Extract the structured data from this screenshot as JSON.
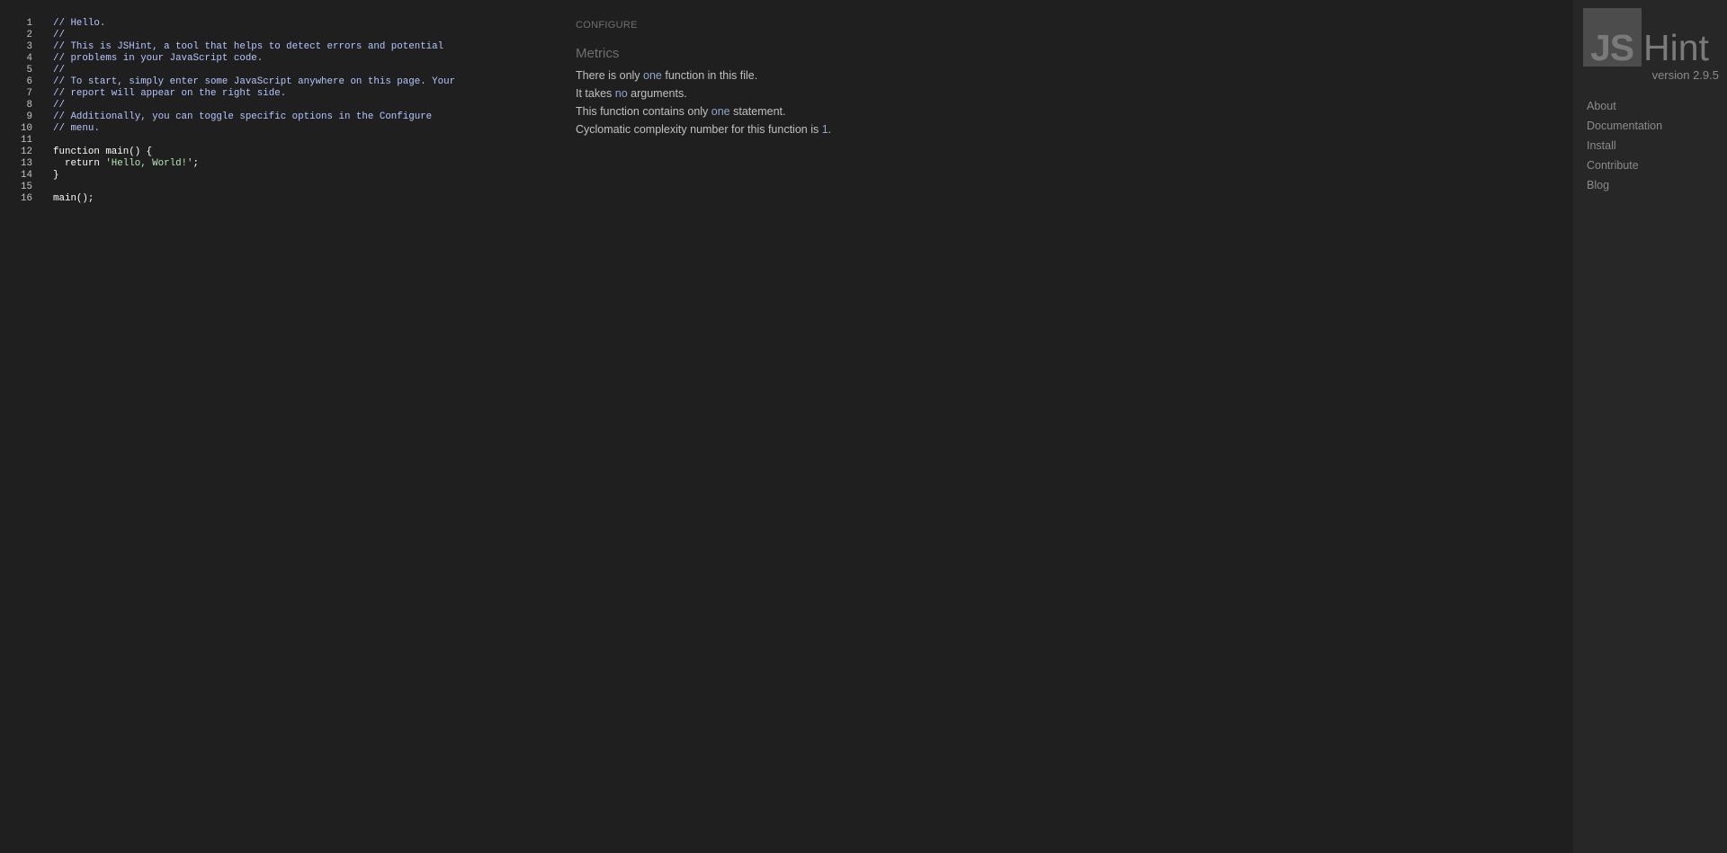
{
  "editor": {
    "lines": [
      {
        "num": "1",
        "code": "// Hello.",
        "type": "comment"
      },
      {
        "num": "2",
        "code": "//",
        "type": "comment"
      },
      {
        "num": "3",
        "code": "// This is JSHint, a tool that helps to detect errors and potential",
        "type": "comment"
      },
      {
        "num": "4",
        "code": "// problems in your JavaScript code.",
        "type": "comment"
      },
      {
        "num": "5",
        "code": "//",
        "type": "comment"
      },
      {
        "num": "6",
        "code": "// To start, simply enter some JavaScript anywhere on this page. Your",
        "type": "comment"
      },
      {
        "num": "7",
        "code": "// report will appear on the right side.",
        "type": "comment"
      },
      {
        "num": "8",
        "code": "//",
        "type": "comment"
      },
      {
        "num": "9",
        "code": "// Additionally, you can toggle specific options in the Configure",
        "type": "comment"
      },
      {
        "num": "10",
        "code": "// menu.",
        "type": "comment"
      },
      {
        "num": "11",
        "code": "",
        "type": "default"
      },
      {
        "num": "12",
        "code": "function main() {",
        "type": "default"
      },
      {
        "num": "13",
        "code": "  return 'Hello, World!';",
        "type": "default"
      },
      {
        "num": "14",
        "code": "}",
        "type": "default"
      },
      {
        "num": "15",
        "code": "",
        "type": "default"
      },
      {
        "num": "16",
        "code": "main();",
        "type": "default"
      }
    ]
  },
  "report": {
    "configure_label": "CONFIGURE",
    "metrics_heading": "Metrics",
    "metrics": [
      {
        "pre": "There is only ",
        "val": "one",
        "post": " function in this file."
      },
      {
        "pre": "It takes ",
        "val": "no",
        "post": " arguments."
      },
      {
        "pre": "This function contains only ",
        "val": "one",
        "post": " statement."
      },
      {
        "pre": "Cyclomatic complexity number for this function is ",
        "val": "1",
        "post": "."
      }
    ]
  },
  "sidebar": {
    "logo_js": "JS",
    "logo_hint": "Hint",
    "version": "version 2.9.5",
    "nav": [
      "About",
      "Documentation",
      "Install",
      "Contribute",
      "Blog"
    ]
  },
  "colors": {
    "background": "#1f1f1f",
    "sidebar_bg": "#272727",
    "comment": "#b3c6ff",
    "code": "#ffffff",
    "string": "#b8e6b8",
    "metric_value": "#8fa6c9"
  }
}
